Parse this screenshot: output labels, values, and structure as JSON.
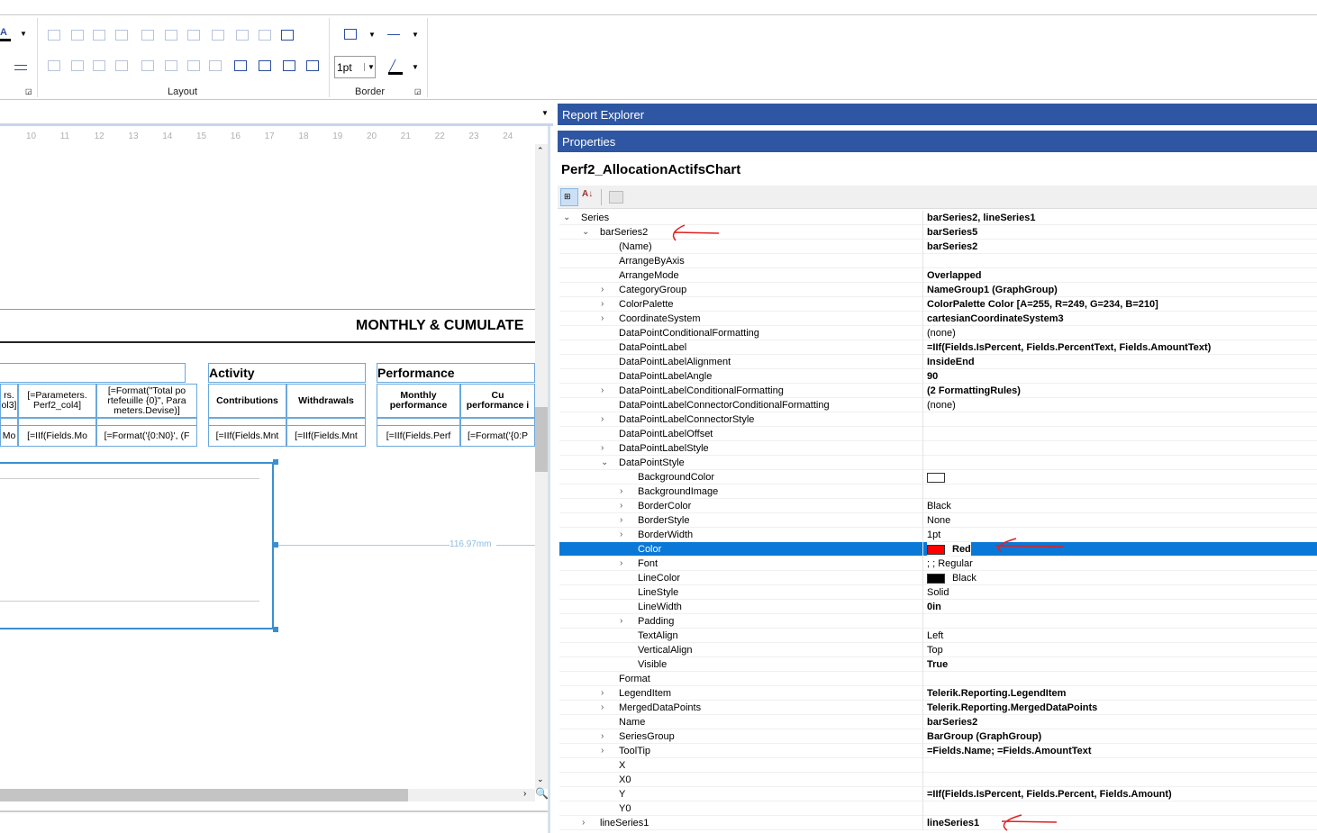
{
  "toolbar": {
    "layout_label": "Layout",
    "border_label": "Border",
    "border_width": "1pt"
  },
  "designer": {
    "ruler": [
      "10",
      "11",
      "12",
      "13",
      "14",
      "15",
      "16",
      "17",
      "18",
      "19",
      "20",
      "21",
      "22",
      "23",
      "24"
    ],
    "report_title": "MONTHLY & CUMULATE",
    "activity": "Activity",
    "performance": "Performance",
    "headers": [
      "rs.\nol3]",
      "[=Parameters.\nPerf2_col4]",
      "[=Format(\"Total po\nrtefeuille {0}\", Para\nmeters.Devise)]",
      "Contributions",
      "Withdrawals",
      "Monthly\nperformance",
      "Cu\nperformance i"
    ],
    "details": [
      "Mo",
      "[=IIf(Fields.Mo",
      "[=Format('{0:N0}', (F",
      "[=IIf(Fields.Mnt",
      "[=IIf(Fields.Mnt",
      "[=IIf(Fields.Perf",
      "[=Format('{0:P"
    ],
    "dimension": "116.97mm"
  },
  "panels": {
    "report_explorer": "Report Explorer",
    "properties": "Properties"
  },
  "properties": {
    "object_name": "Perf2_AllocationActifsChart",
    "rows": [
      {
        "name": "Series",
        "lvl": 0,
        "exp": "open",
        "value": "barSeries2, lineSeries1",
        "b": true
      },
      {
        "name": "barSeries2",
        "lvl": 1,
        "exp": "open",
        "value": "barSeries5",
        "b": true
      },
      {
        "name": "(Name)",
        "lvl": 2,
        "value": "barSeries2",
        "b": true
      },
      {
        "name": "ArrangeByAxis",
        "lvl": 2,
        "value": ""
      },
      {
        "name": "ArrangeMode",
        "lvl": 2,
        "value": "Overlapped",
        "b": true
      },
      {
        "name": "CategoryGroup",
        "lvl": 2,
        "exp": "closed",
        "value": "NameGroup1 (GraphGroup)",
        "b": true
      },
      {
        "name": "ColorPalette",
        "lvl": 2,
        "exp": "closed",
        "value": "ColorPalette Color [A=255, R=249, G=234, B=210]",
        "b": true
      },
      {
        "name": "CoordinateSystem",
        "lvl": 2,
        "exp": "closed",
        "value": "cartesianCoordinateSystem3",
        "b": true
      },
      {
        "name": "DataPointConditionalFormatting",
        "lvl": 2,
        "value": "(none)"
      },
      {
        "name": "DataPointLabel",
        "lvl": 2,
        "value": "=IIf(Fields.IsPercent, Fields.PercentText, Fields.AmountText)",
        "b": true
      },
      {
        "name": "DataPointLabelAlignment",
        "lvl": 2,
        "value": "InsideEnd",
        "b": true
      },
      {
        "name": "DataPointLabelAngle",
        "lvl": 2,
        "value": "90",
        "b": true
      },
      {
        "name": "DataPointLabelConditionalFormatting",
        "lvl": 2,
        "exp": "closed",
        "value": "(2 FormattingRules)",
        "b": true
      },
      {
        "name": "DataPointLabelConnectorConditionalFormatting",
        "lvl": 2,
        "value": "(none)"
      },
      {
        "name": "DataPointLabelConnectorStyle",
        "lvl": 2,
        "exp": "closed",
        "value": ""
      },
      {
        "name": "DataPointLabelOffset",
        "lvl": 2,
        "value": ""
      },
      {
        "name": "DataPointLabelStyle",
        "lvl": 2,
        "exp": "closed",
        "value": ""
      },
      {
        "name": "DataPointStyle",
        "lvl": 2,
        "exp": "open",
        "value": ""
      },
      {
        "name": "BackgroundColor",
        "lvl": 3,
        "value": "",
        "swatch": "#ffffff"
      },
      {
        "name": "BackgroundImage",
        "lvl": 3,
        "exp": "closed",
        "value": ""
      },
      {
        "name": "BorderColor",
        "lvl": 3,
        "exp": "closed",
        "value": "Black"
      },
      {
        "name": "BorderStyle",
        "lvl": 3,
        "exp": "closed",
        "value": "None"
      },
      {
        "name": "BorderWidth",
        "lvl": 3,
        "exp": "closed",
        "value": "1pt"
      },
      {
        "name": "Color",
        "lvl": 3,
        "value": "Red",
        "b": true,
        "swatch": "#ff0000",
        "selected": true
      },
      {
        "name": "Font",
        "lvl": 3,
        "exp": "closed",
        "value": "; ; Regular"
      },
      {
        "name": "LineColor",
        "lvl": 3,
        "value": "Black",
        "swatch": "#000000"
      },
      {
        "name": "LineStyle",
        "lvl": 3,
        "value": "Solid"
      },
      {
        "name": "LineWidth",
        "lvl": 3,
        "value": "0in",
        "b": true
      },
      {
        "name": "Padding",
        "lvl": 3,
        "exp": "closed",
        "value": ""
      },
      {
        "name": "TextAlign",
        "lvl": 3,
        "value": "Left"
      },
      {
        "name": "VerticalAlign",
        "lvl": 3,
        "value": "Top"
      },
      {
        "name": "Visible",
        "lvl": 3,
        "value": "True",
        "b": true
      },
      {
        "name": "Format",
        "lvl": 2,
        "value": ""
      },
      {
        "name": "LegendItem",
        "lvl": 2,
        "exp": "closed",
        "value": "Telerik.Reporting.LegendItem",
        "b": true
      },
      {
        "name": "MergedDataPoints",
        "lvl": 2,
        "exp": "closed",
        "value": "Telerik.Reporting.MergedDataPoints",
        "b": true
      },
      {
        "name": "Name",
        "lvl": 2,
        "value": "barSeries2",
        "b": true
      },
      {
        "name": "SeriesGroup",
        "lvl": 2,
        "exp": "closed",
        "value": "BarGroup (GraphGroup)",
        "b": true
      },
      {
        "name": "ToolTip",
        "lvl": 2,
        "exp": "closed",
        "value": "=Fields.Name; =Fields.AmountText",
        "b": true
      },
      {
        "name": "X",
        "lvl": 2,
        "value": ""
      },
      {
        "name": "X0",
        "lvl": 2,
        "value": ""
      },
      {
        "name": "Y",
        "lvl": 2,
        "value": "=IIf(Fields.IsPercent, Fields.Percent, Fields.Amount)",
        "b": true
      },
      {
        "name": "Y0",
        "lvl": 2,
        "value": ""
      },
      {
        "name": "lineSeries1",
        "lvl": 1,
        "exp": "closed",
        "value": "lineSeries1",
        "b": true
      }
    ]
  },
  "colors": {
    "header_bg": "#2e56a2",
    "selection": "#0a78d7",
    "annotation": "#e02020"
  }
}
